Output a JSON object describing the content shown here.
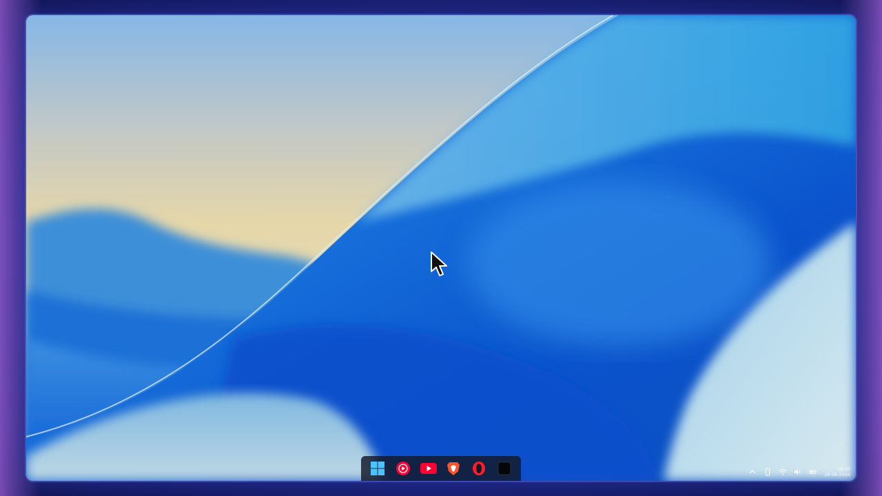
{
  "desktop": {
    "taskbar": {
      "apps": [
        {
          "name": "start-button",
          "icon": "windows-icon"
        },
        {
          "name": "youtube-music-button",
          "icon": "youtube-music-icon"
        },
        {
          "name": "youtube-button",
          "icon": "youtube-icon"
        },
        {
          "name": "brave-button",
          "icon": "brave-lion-icon"
        },
        {
          "name": "opera-button",
          "icon": "opera-icon"
        },
        {
          "name": "terminal-button",
          "icon": "black-square-app-icon"
        }
      ]
    },
    "tray": {
      "time": "18:35",
      "date": "28-08-2026"
    }
  },
  "colors": {
    "accent_blue": "#0a5fd8",
    "taskbar_bg": "#121826",
    "youtube_red": "#ff0033",
    "brave_orange": "#fb542b",
    "opera_red": "#ff1b2d"
  }
}
